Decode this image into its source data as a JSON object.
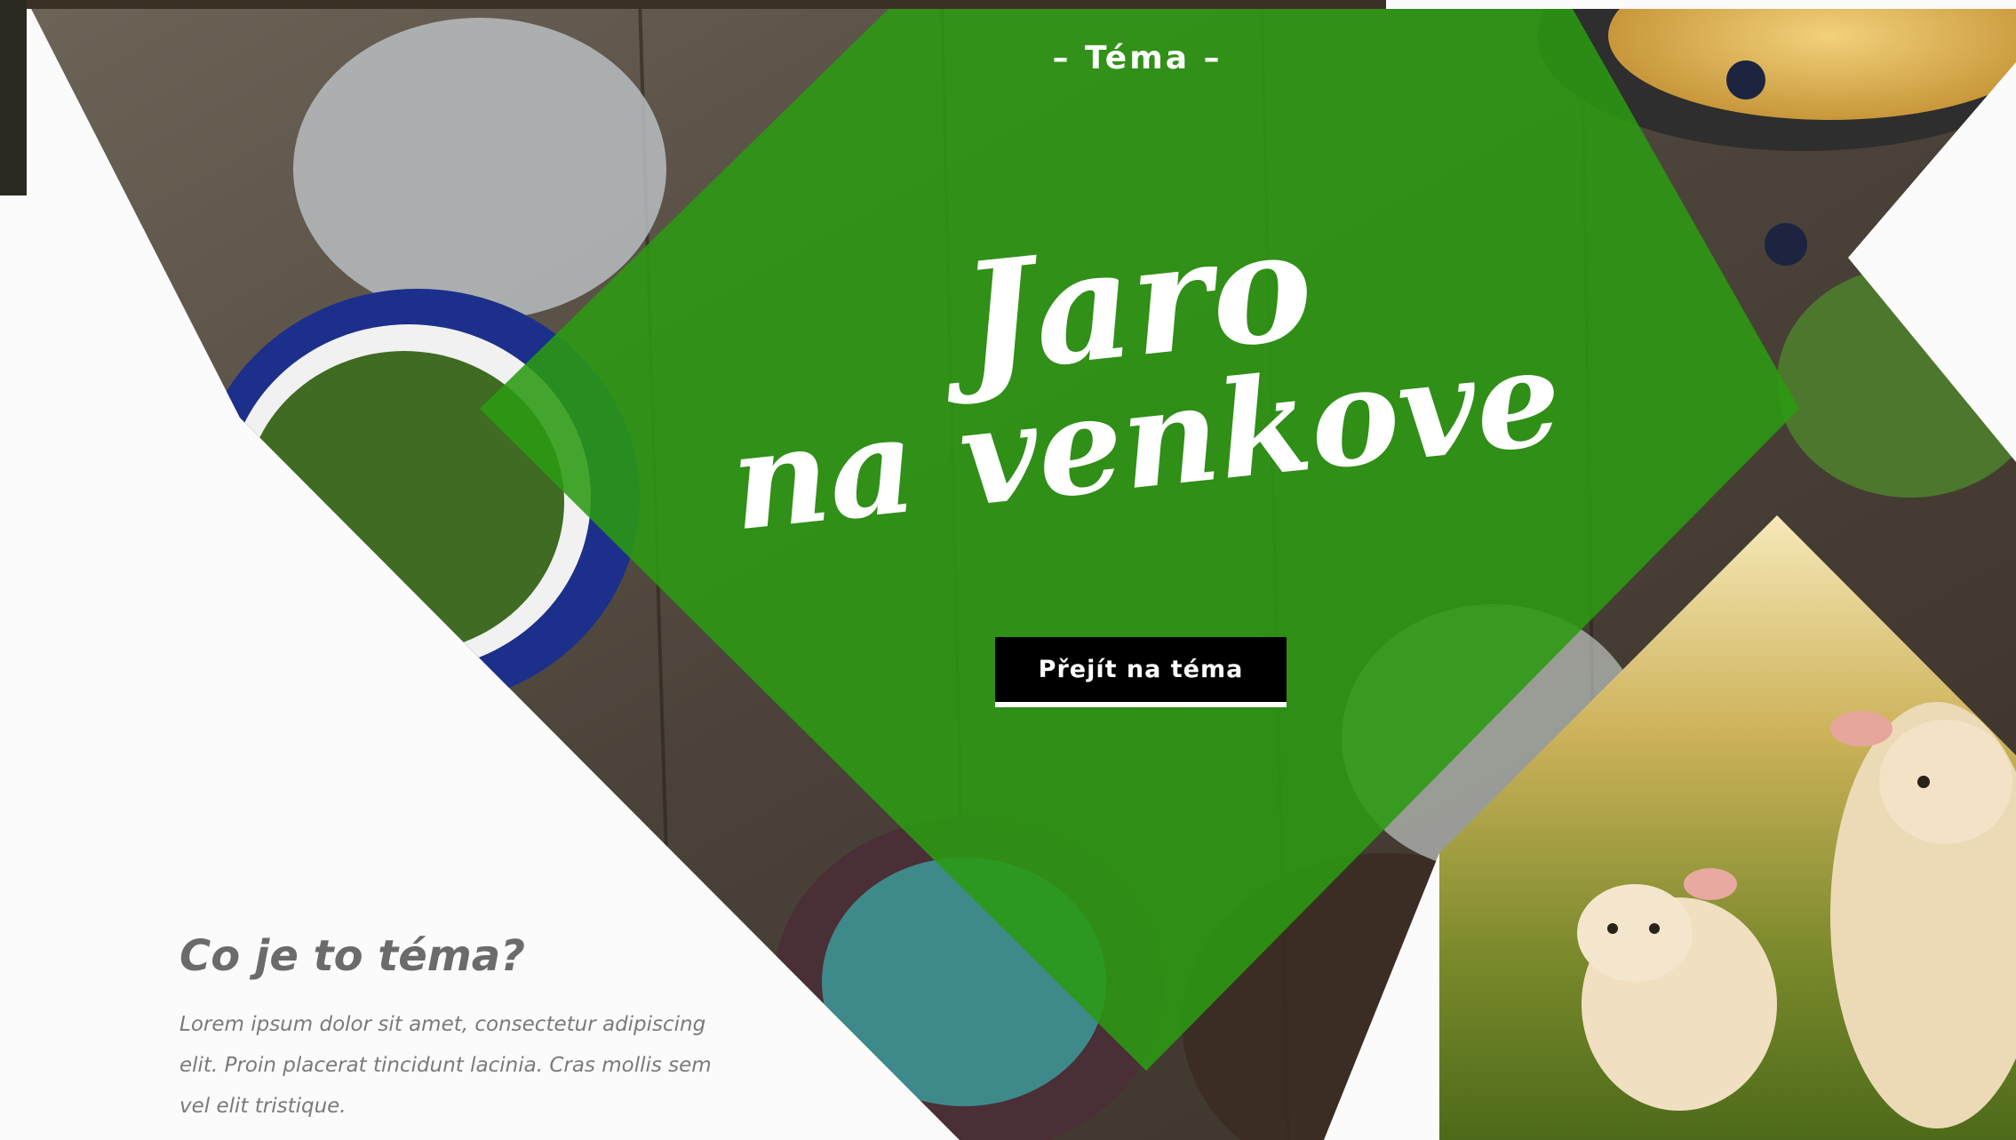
{
  "hero": {
    "kicker": "– Téma –",
    "title_line1": "Jaro",
    "title_line2": "na venkove",
    "cta_label": "Přejít na téma"
  },
  "info": {
    "title": "Co je to téma?",
    "body": "Lorem ipsum dolor sit amet, consectetur adipiscing elit. Proin placerat tincidunt lacinia. Cras mollis sem vel elit tristique."
  },
  "colors": {
    "accent_green": "#2b9a12",
    "button_bg": "#000000",
    "text_gray": "#6b6b6b"
  }
}
